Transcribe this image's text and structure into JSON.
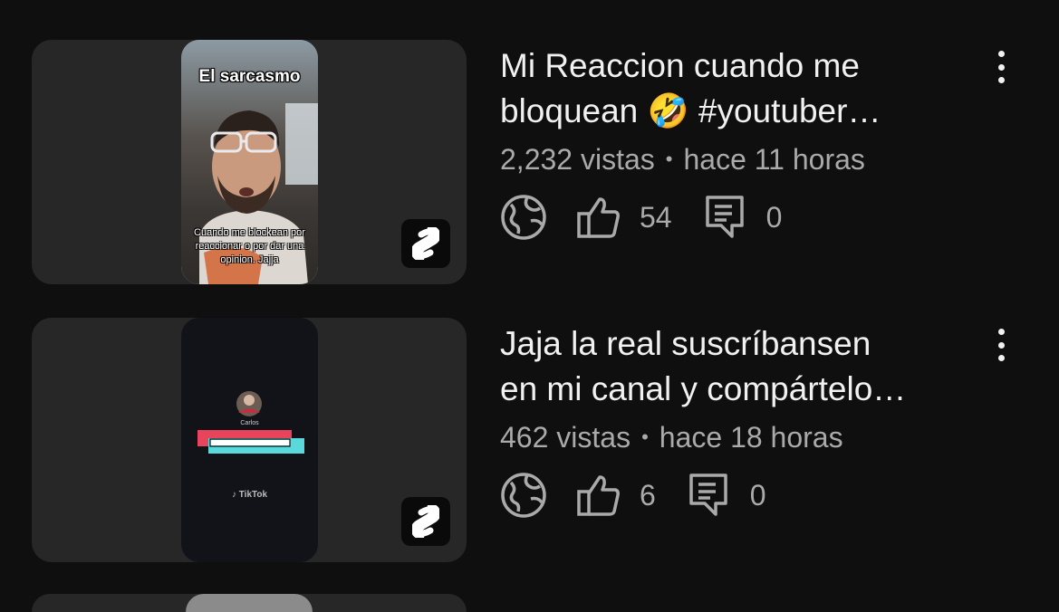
{
  "videos": [
    {
      "title_line1": "Mi Reaccion cuando me",
      "title_line2": "bloquean 🤣 #youtuber…",
      "views": "2,232 vistas",
      "separator": "•",
      "time": "hace 11 horas",
      "likes": "54",
      "comments": "0",
      "thumb_top_text": "El sarcasmo",
      "thumb_bottom_text": "Cuando me blockean por reaccionar o por dar una opinion. Jajja"
    },
    {
      "title_line1": "Jaja la real suscríbansen",
      "title_line2": "en mi canal y compártelo…",
      "views": "462 vistas",
      "separator": "•",
      "time": "hace 18 horas",
      "likes": "6",
      "comments": "0",
      "thumb_name": "Carlos",
      "thumb_brand": "TikTok"
    }
  ],
  "icons": {
    "visibility": "globe-icon",
    "likes": "thumbs-up-icon",
    "comments": "comment-icon",
    "more": "more-vertical-icon",
    "shorts": "shorts-logo-icon"
  },
  "colors": {
    "background": "#0f0f0f",
    "card": "#272727",
    "primary_text": "#f1f1f1",
    "secondary_text": "#aaaaaa"
  }
}
